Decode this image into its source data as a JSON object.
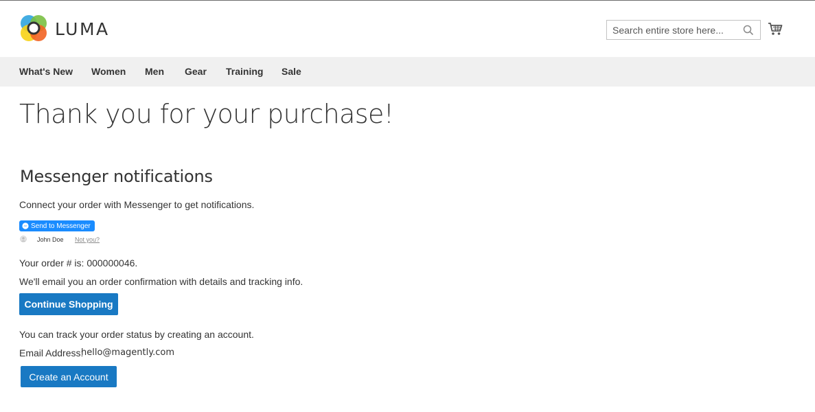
{
  "header": {
    "logo_text": "LUMA",
    "search": {
      "placeholder": "Search entire store here..."
    }
  },
  "nav": {
    "items": [
      {
        "label": "What's New"
      },
      {
        "label": "Women"
      },
      {
        "label": "Men"
      },
      {
        "label": "Gear"
      },
      {
        "label": "Training"
      },
      {
        "label": "Sale"
      }
    ]
  },
  "main": {
    "title": "Thank you for your purchase!",
    "messenger": {
      "heading": "Messenger notifications",
      "description": "Connect your order with Messenger to get notifications.",
      "button_label": "Send to Messenger",
      "user_name": "John Doe",
      "not_you_label": "Not you?"
    },
    "order": {
      "number_text": "Your order # is: 000000046.",
      "confirmation_text": "We'll email you an order confirmation with details and tracking info.",
      "continue_label": "Continue Shopping"
    },
    "account": {
      "track_text": "You can track your order status by creating an account.",
      "email_label": "Email Address:",
      "email_value": "hello@magently.com",
      "create_label": "Create an Account"
    }
  },
  "colors": {
    "primary_button": "#1979c3",
    "messenger_blue": "#1a8cff",
    "nav_background": "#f0f0f0"
  },
  "icons": {
    "logo": "luma-logo-icon",
    "search": "search-icon",
    "cart": "cart-icon",
    "messenger": "messenger-icon",
    "avatar": "user-avatar-icon"
  }
}
